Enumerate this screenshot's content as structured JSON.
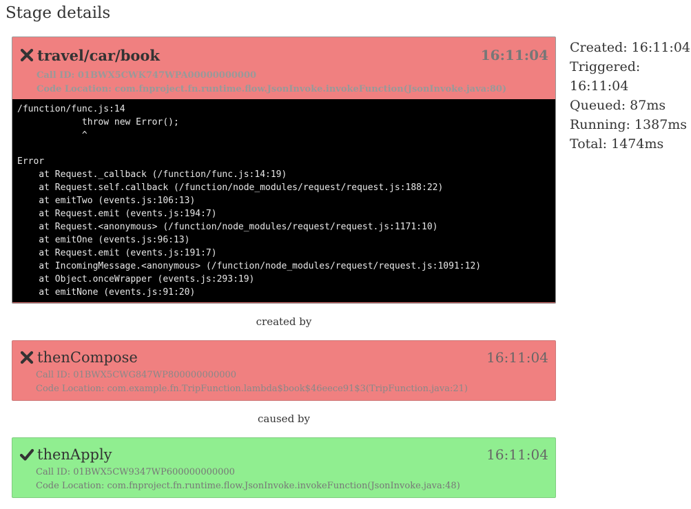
{
  "page": {
    "title": "Stage details"
  },
  "primary_stage": {
    "status": "failed",
    "status_icon": "cross-icon",
    "name": "travel/car/book",
    "time": "16:11:04",
    "call_id": "Call ID: 01BWX5CWK747WPA00000000000",
    "code_location": "Code Location: com.fnproject.fn.runtime.flow.JsonInvoke.invokeFunction(JsonInvoke.java:80)",
    "stack_trace": "/function/func.js:14\n            throw new Error();\n            ^\n\nError\n    at Request._callback (/function/func.js:14:19)\n    at Request.self.callback (/function/node_modules/request/request.js:188:22)\n    at emitTwo (events.js:106:13)\n    at Request.emit (events.js:194:7)\n    at Request.<anonymous> (/function/node_modules/request/request.js:1171:10)\n    at emitOne (events.js:96:13)\n    at Request.emit (events.js:191:7)\n    at IncomingMessage.<anonymous> (/function/node_modules/request/request.js:1091:12)\n    at Object.onceWrapper (events.js:293:19)\n    at emitNone (events.js:91:20)"
  },
  "relation_1": "created by",
  "creator_stage": {
    "status": "failed",
    "status_icon": "cross-icon",
    "name": "thenCompose",
    "time": "16:11:04",
    "call_id": "Call ID: 01BWX5CWG847WP800000000000",
    "code_location": "Code Location: com.example.fn.TripFunction.lambda$book$46eece91$3(TripFunction.java:21)"
  },
  "relation_2": "caused by",
  "cause_stage": {
    "status": "success",
    "status_icon": "check-icon",
    "name": "thenApply",
    "time": "16:11:04",
    "call_id": "Call ID: 01BWX5CW9347WP600000000000",
    "code_location": "Code Location: com.fnproject.fn.runtime.flow.JsonInvoke.invokeFunction(JsonInvoke.java:48)"
  },
  "stats": {
    "created": "Created: 16:11:04",
    "triggered": "Triggered: 16:11:04",
    "queued": "Queued: 87ms",
    "running": "Running: 1387ms",
    "total": "Total: 1474ms"
  },
  "colors": {
    "failed": "#f08080",
    "success": "#90ee90",
    "stack_bg": "#000000"
  }
}
